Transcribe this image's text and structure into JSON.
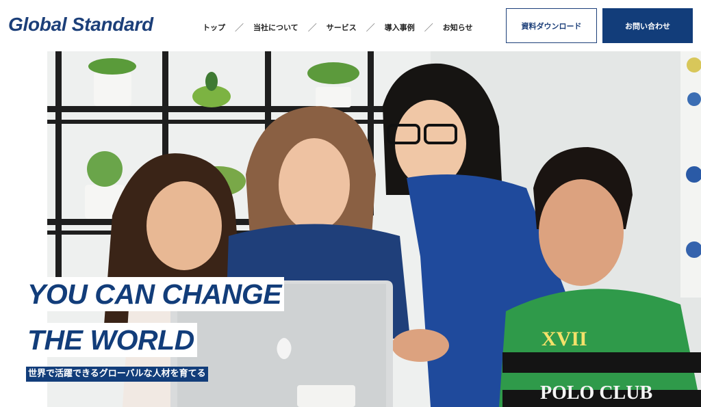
{
  "header": {
    "logo": "Global Standard",
    "nav": [
      {
        "label": "トップ"
      },
      {
        "label": "当社について"
      },
      {
        "label": "サービス"
      },
      {
        "label": "導入事例"
      },
      {
        "label": "お知らせ"
      }
    ],
    "nav_separator": "／",
    "download_button": "資料ダウンロード",
    "contact_button": "お問い合わせ"
  },
  "hero": {
    "catch_line_1": "YOU CAN CHANGE",
    "catch_line_2": "THE WORLD",
    "subcopy": "世界で活躍できるグローバルな人材を育てる",
    "photo_overlay_text": "POLO CLUB",
    "shirt_number": "XVII"
  },
  "colors": {
    "brand_navy": "#123d7a",
    "logo_navy": "#1c3f79",
    "background": "#ffffff",
    "shirt_green": "#2f9a4a",
    "top_blue": "#1f4a9c"
  }
}
